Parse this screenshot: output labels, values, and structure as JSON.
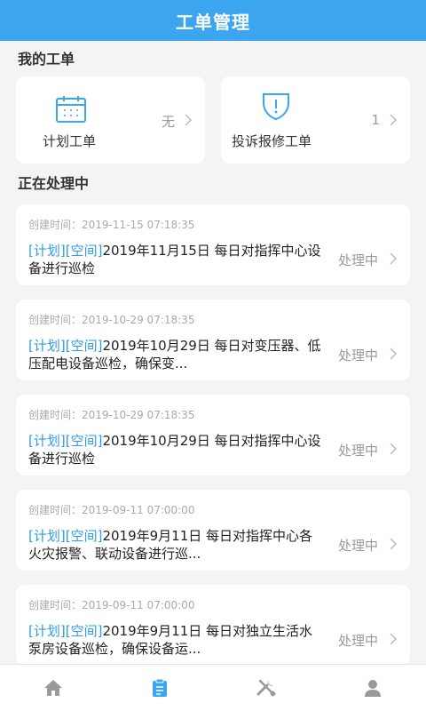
{
  "header": {
    "title": "工单管理"
  },
  "my_orders": {
    "title": "我的工单",
    "cards": [
      {
        "label": "计划工单",
        "value": "无",
        "icon": "calendar-icon"
      },
      {
        "label": "投诉报修工单",
        "value": "1",
        "icon": "shield-alert-icon"
      }
    ]
  },
  "processing": {
    "title": "正在处理中",
    "items": [
      {
        "time": "创建时间：2019-11-15 07:18:35",
        "tag1": "[计划]",
        "tag2": "[空间]",
        "text": "2019年11月15日 每日对指挥中心设备进行巡检",
        "status": "处理中"
      },
      {
        "time": "创建时间：2019-10-29 07:18:35",
        "tag1": "[计划]",
        "tag2": "[空间]",
        "text": "2019年10月29日 每日对变压器、低压配电设备巡检，确保变...",
        "status": "处理中"
      },
      {
        "time": "创建时间：2019-10-29 07:18:35",
        "tag1": "[计划]",
        "tag2": "[空间]",
        "text": "2019年10月29日 每日对指挥中心设备进行巡检",
        "status": "处理中"
      },
      {
        "time": "创建时间：2019-09-11 07:00:00",
        "tag1": "[计划]",
        "tag2": "[空间]",
        "text": "2019年9月11日 每日对指挥中心各火灾报警、联动设备进行巡...",
        "status": "处理中"
      },
      {
        "time": "创建时间：2019-09-11 07:00:00",
        "tag1": "[计划]",
        "tag2": "[空间]",
        "text": "2019年9月11日 每日对独立生活水泵房设备巡检，确保设备运...",
        "status": "处理中"
      }
    ]
  },
  "tabbar": {
    "tabs": [
      {
        "icon": "home-icon",
        "active": false
      },
      {
        "icon": "clipboard-icon",
        "active": true
      },
      {
        "icon": "tools-icon",
        "active": false
      },
      {
        "icon": "user-icon",
        "active": false
      }
    ]
  },
  "colors": {
    "primary": "#3ba5f0",
    "tag": "#2e9be6",
    "active_tab": "#3ba5f0",
    "inactive_tab": "#999999"
  }
}
